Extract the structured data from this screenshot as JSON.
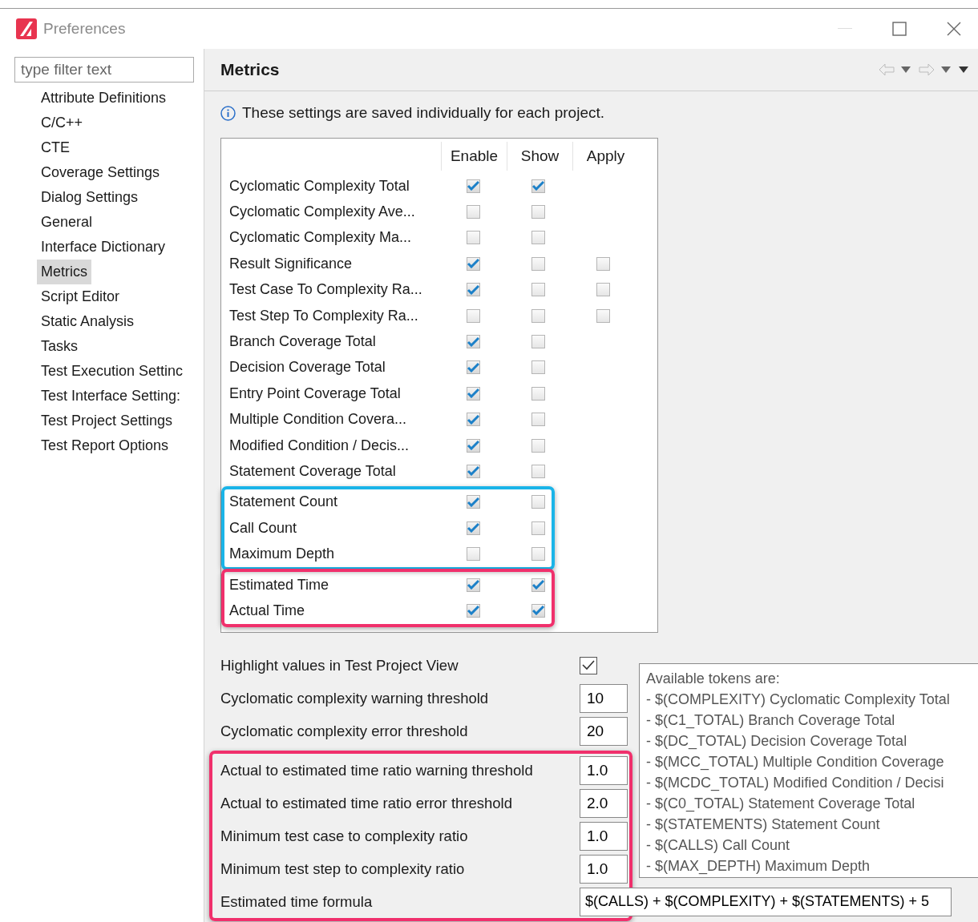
{
  "window": {
    "title": "Preferences"
  },
  "sidebar": {
    "filter": {
      "placeholder": "type filter text"
    },
    "items": [
      {
        "label": "Attribute Definitions",
        "selected": false
      },
      {
        "label": "C/C++",
        "selected": false
      },
      {
        "label": "CTE",
        "selected": false
      },
      {
        "label": "Coverage Settings",
        "selected": false
      },
      {
        "label": "Dialog Settings",
        "selected": false
      },
      {
        "label": "General",
        "selected": false
      },
      {
        "label": "Interface Dictionary",
        "selected": false
      },
      {
        "label": "Metrics",
        "selected": true
      },
      {
        "label": "Script Editor",
        "selected": false
      },
      {
        "label": "Static Analysis",
        "selected": false
      },
      {
        "label": "Tasks",
        "selected": false
      },
      {
        "label": "Test Execution Settinc",
        "selected": false
      },
      {
        "label": "Test Interface Setting:",
        "selected": false
      },
      {
        "label": "Test Project Settings",
        "selected": false
      },
      {
        "label": "Test Report Options",
        "selected": false
      }
    ]
  },
  "page": {
    "title": "Metrics",
    "info": "These settings are saved individually for each project.",
    "metrics": {
      "columns": [
        "Enable",
        "Show",
        "Apply"
      ],
      "groups": [
        {
          "rows": [
            {
              "name": "Cyclomatic Complexity Total",
              "enable": true,
              "show": true
            },
            {
              "name": "Cyclomatic Complexity Ave...",
              "enable": false,
              "show": false
            },
            {
              "name": "Cyclomatic Complexity Ma...",
              "enable": false,
              "show": false
            },
            {
              "name": "Result Significance",
              "enable": true,
              "show": false,
              "apply": false
            },
            {
              "name": "Test Case To Complexity Ra...",
              "enable": true,
              "show": false,
              "apply": false
            },
            {
              "name": "Test Step To Complexity Ra...",
              "enable": false,
              "show": false,
              "apply": false
            },
            {
              "name": "Branch Coverage Total",
              "enable": true,
              "show": false
            },
            {
              "name": "Decision Coverage Total",
              "enable": true,
              "show": false
            },
            {
              "name": "Entry Point Coverage Total",
              "enable": true,
              "show": false
            },
            {
              "name": "Multiple Condition Covera...",
              "enable": true,
              "show": false
            },
            {
              "name": "Modified Condition / Decis...",
              "enable": true,
              "show": false
            },
            {
              "name": "Statement Coverage Total",
              "enable": true,
              "show": false
            }
          ]
        },
        {
          "color": "#1ab4e8",
          "rows": [
            {
              "name": "Statement Count",
              "enable": true,
              "show": false
            },
            {
              "name": "Call Count",
              "enable": true,
              "show": false
            },
            {
              "name": "Maximum Depth",
              "enable": false,
              "show": false
            }
          ]
        },
        {
          "color": "#f0306c",
          "rows": [
            {
              "name": "Estimated Time",
              "enable": true,
              "show": true
            },
            {
              "name": "Actual Time",
              "enable": true,
              "show": true
            }
          ]
        }
      ]
    },
    "settings": {
      "groups": [
        {
          "rows": [
            {
              "kind": "checkbox",
              "label": "Highlight values in Test Project View",
              "checked": true
            },
            {
              "kind": "number",
              "label": "Cyclomatic complexity warning threshold",
              "value": "10"
            },
            {
              "kind": "number",
              "label": "Cyclomatic complexity error threshold",
              "value": "20"
            }
          ]
        },
        {
          "color": "#f0306c",
          "rows": [
            {
              "kind": "number",
              "label": "Actual to estimated time ratio warning threshold",
              "value": "1.0"
            },
            {
              "kind": "number",
              "label": "Actual to estimated time ratio error threshold",
              "value": "2.0"
            },
            {
              "kind": "number",
              "label": "Minimum test case to complexity ratio",
              "value": "1.0"
            },
            {
              "kind": "number",
              "label": "Minimum test step to complexity ratio",
              "value": "1.0"
            },
            {
              "kind": "formula",
              "label": "Estimated time formula",
              "value": "$(CALLS) + $(COMPLEXITY) + $(STATEMENTS) + 5"
            }
          ]
        }
      ]
    },
    "tooltip": {
      "title": "Available tokens are:",
      "lines": [
        "- $(COMPLEXITY) Cyclomatic Complexity Total",
        "- $(C1_TOTAL) Branch Coverage Total",
        "- $(DC_TOTAL) Decision Coverage Total",
        "- $(MCC_TOTAL) Multiple Condition Coverage",
        "- $(MCDC_TOTAL) Modified Condition / Decisi",
        "- $(C0_TOTAL) Statement Coverage Total",
        "- $(STATEMENTS) Statement Count",
        "- $(CALLS) Call Count",
        "- $(MAX_DEPTH) Maximum Depth"
      ]
    }
  }
}
